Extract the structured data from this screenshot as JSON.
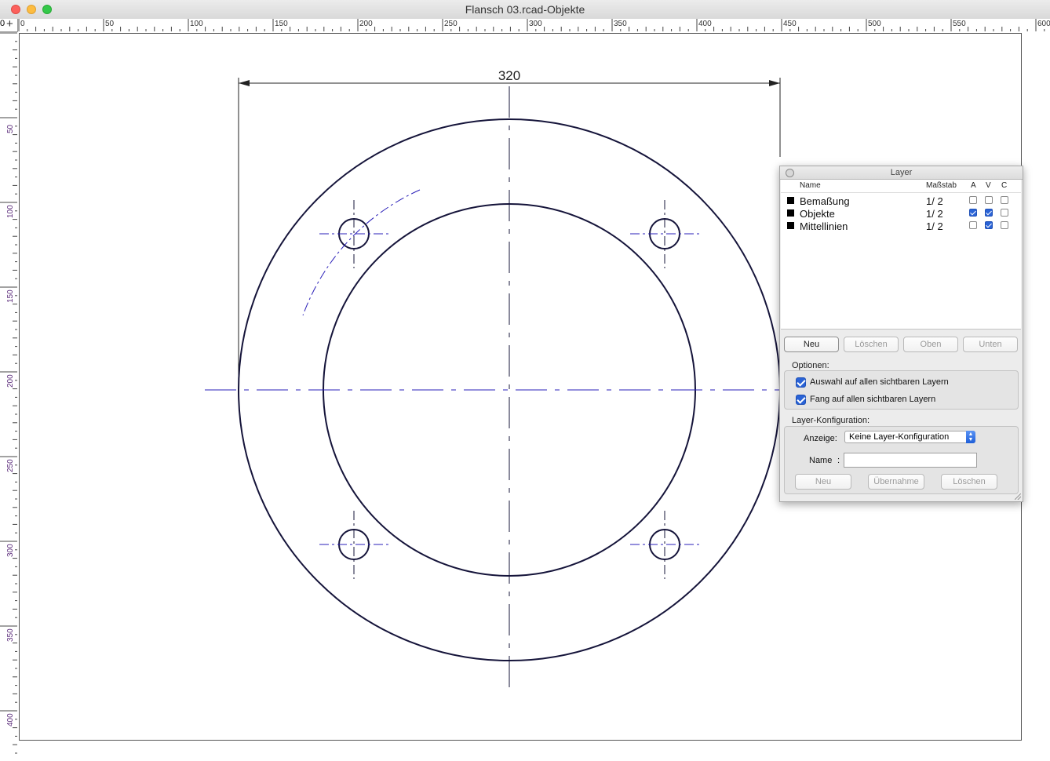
{
  "window": {
    "title": "Flansch 03.rcad-Objekte"
  },
  "ruler": {
    "corner_label": "0",
    "corner_plus": "+",
    "top_labels": [
      "0",
      "50",
      "100",
      "150",
      "200",
      "250",
      "300",
      "350",
      "400",
      "450",
      "500",
      "550",
      "600"
    ],
    "left_labels": [
      "50",
      "100",
      "150",
      "200",
      "250",
      "300",
      "350",
      "400"
    ]
  },
  "drawing": {
    "dimension_text": "320",
    "line_color": "#15143a",
    "centerline_color": "#2a1fb8"
  },
  "layer_panel": {
    "title": "Layer",
    "headers": {
      "name": "Name",
      "scale": "Maßstab",
      "a": "A",
      "v": "V",
      "c": "C"
    },
    "layers": [
      {
        "name": "Bemaßung",
        "scale": "1/  2",
        "a": false,
        "v": false,
        "c": false
      },
      {
        "name": "Objekte",
        "scale": "1/  2",
        "a": true,
        "v": true,
        "c": false
      },
      {
        "name": "Mittellinien",
        "scale": "1/  2",
        "a": false,
        "v": true,
        "c": false
      }
    ],
    "buttons": {
      "new": "Neu",
      "delete": "Löschen",
      "up": "Oben",
      "down": "Unten"
    },
    "options_label": "Optionen:",
    "options": [
      {
        "label": "Auswahl auf allen sichtbaren Layern",
        "checked": true
      },
      {
        "label": "Fang auf allen sichtbaren Layern",
        "checked": true
      }
    ],
    "config": {
      "label": "Layer-Konfiguration:",
      "display_label": "Anzeige:",
      "display_value": "Keine Layer-Konfiguration",
      "name_label": "Name",
      "name_colon": ":",
      "name_value": "",
      "buttons": {
        "new": "Neu",
        "apply": "Übernahme",
        "delete": "Löschen"
      }
    }
  }
}
